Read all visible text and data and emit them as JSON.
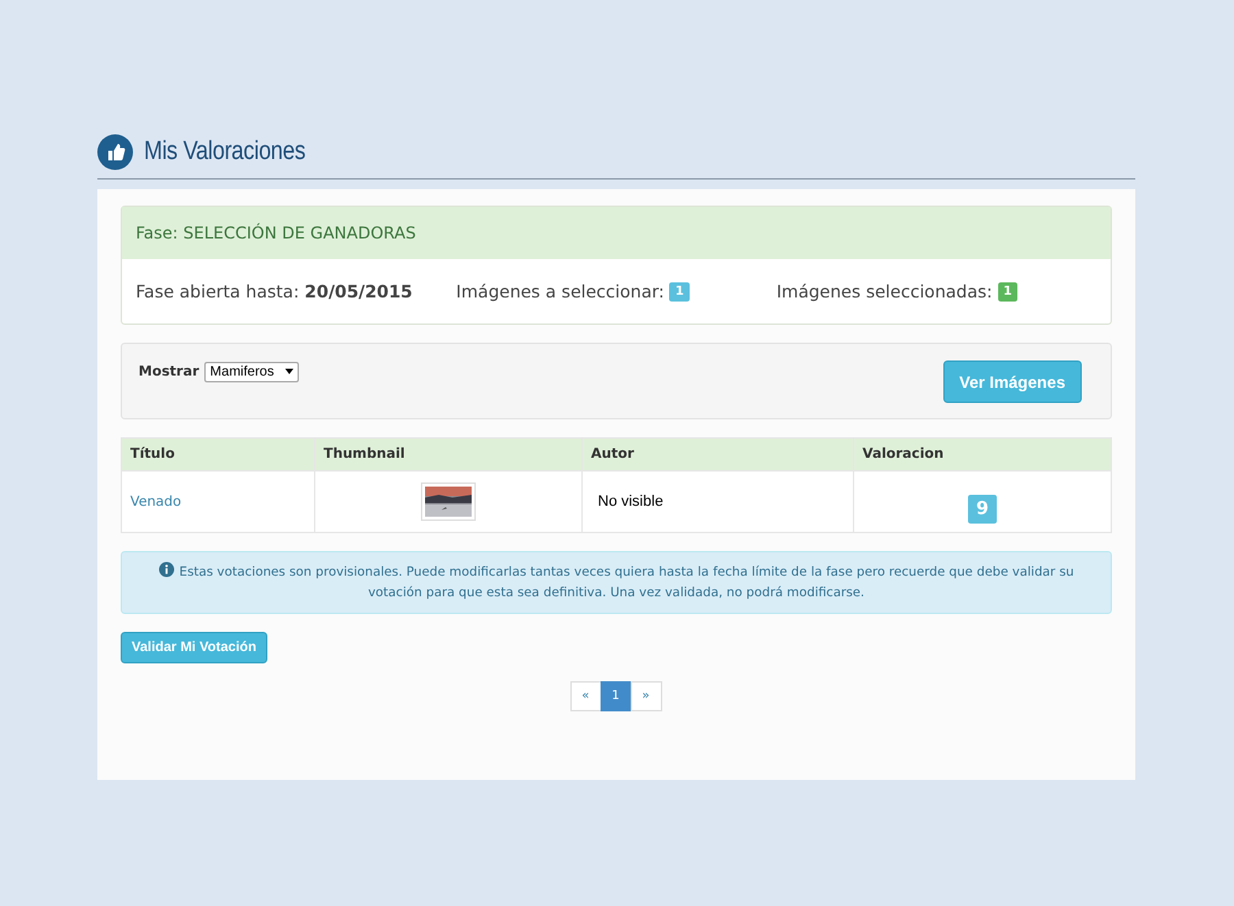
{
  "page": {
    "title": "Mis Valoraciones"
  },
  "phase": {
    "title": "Fase: SELECCIÓN DE GANADORAS",
    "open_until_label": "Fase abierta hasta:",
    "open_until": "20/05/2015",
    "to_select_label": "Imágenes a seleccionar:",
    "to_select": "1",
    "selected_label": "Imágenes seleccionadas:",
    "selected_count": "1"
  },
  "filter": {
    "label": "Mostrar",
    "value": "Mamiferos",
    "button": "Ver Imágenes"
  },
  "table": {
    "columns": [
      "Título",
      "Thumbnail",
      "Autor",
      "Valoracion"
    ],
    "rows": [
      {
        "title": "Venado",
        "author": "No visible",
        "rating": "9"
      }
    ]
  },
  "notice": "Estas votaciones son provisionales. Puede modificarlas tantas veces quiera hasta la fecha límite de la fase pero recuerde que debe validar su votación para que esta sea definitiva. Una vez validada, no podrá modificarse.",
  "validate_button": "Validar Mi Votación",
  "pagination": [
    {
      "label": "«",
      "selected": false
    },
    {
      "label": "1",
      "selected": true
    },
    {
      "label": "»",
      "selected": false
    }
  ]
}
